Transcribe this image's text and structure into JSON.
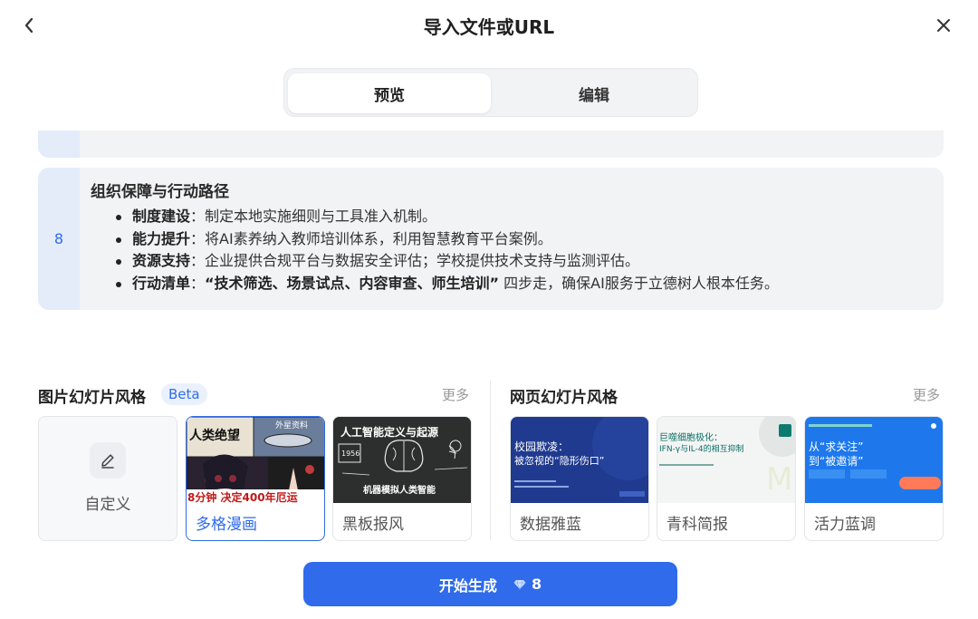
{
  "header": {
    "title": "导入文件或URL",
    "back_icon": "chevron-left-icon",
    "close_icon": "close-icon"
  },
  "tabs": [
    {
      "label": "预览",
      "active": true
    },
    {
      "label": "编辑",
      "active": false
    }
  ],
  "outline": {
    "card": {
      "number": "8",
      "title": "组织保障与行动路径",
      "bullets": [
        {
          "term": "制度建设",
          "sep": "：",
          "text": "制定本地实施细则与工具准入机制。"
        },
        {
          "term": "能力提升",
          "sep": "：",
          "text": "将AI素养纳入教师培训体系，利用智慧教育平台案例。"
        },
        {
          "term": "资源支持",
          "sep": "：",
          "text": "企业提供合规平台与数据安全评估；学校提供技术支持与监测评估。"
        },
        {
          "term": "行动清单",
          "sep": "：",
          "text_bold": "“技术筛选、场景试点、内容审查、师生培训”",
          "text": "四步走，确保AI服务于立德树人根本任务。"
        }
      ]
    }
  },
  "image_styles": {
    "title": "图片幻灯片风格",
    "badge": "Beta",
    "more": "更多",
    "items": [
      {
        "label": "自定义",
        "icon": "pencil-icon",
        "selected": false
      },
      {
        "label": "多格漫画",
        "selected": true,
        "thumb_texts": [
          "人类绝望",
          "外星资料",
          "8分钟 决定400年厄运"
        ]
      },
      {
        "label": "黑板报风",
        "selected": false,
        "thumb_texts": [
          "人工智能定义与起源",
          "1956",
          "机器模拟人类智能"
        ]
      }
    ]
  },
  "web_styles": {
    "title": "网页幻灯片风格",
    "more": "更多",
    "items": [
      {
        "label": "数据雅蓝",
        "thumb_texts": [
          "校园欺凌：",
          "被忽视的“隐形伤口”"
        ]
      },
      {
        "label": "青科简报",
        "thumb_texts": [
          "巨噬细胞极化：",
          "IFN-γ与IL-4的相互抑制"
        ]
      },
      {
        "label": "活力蓝调",
        "thumb_texts": [
          "从“求关注”",
          "到“被邀请”"
        ]
      }
    ]
  },
  "start_button": {
    "label": "开始生成",
    "icon": "diamond-icon",
    "cost": "8"
  },
  "colors": {
    "accent": "#2f6bea",
    "card_bg": "#f2f3f5",
    "number_col_bg": "#e4ecfa"
  }
}
